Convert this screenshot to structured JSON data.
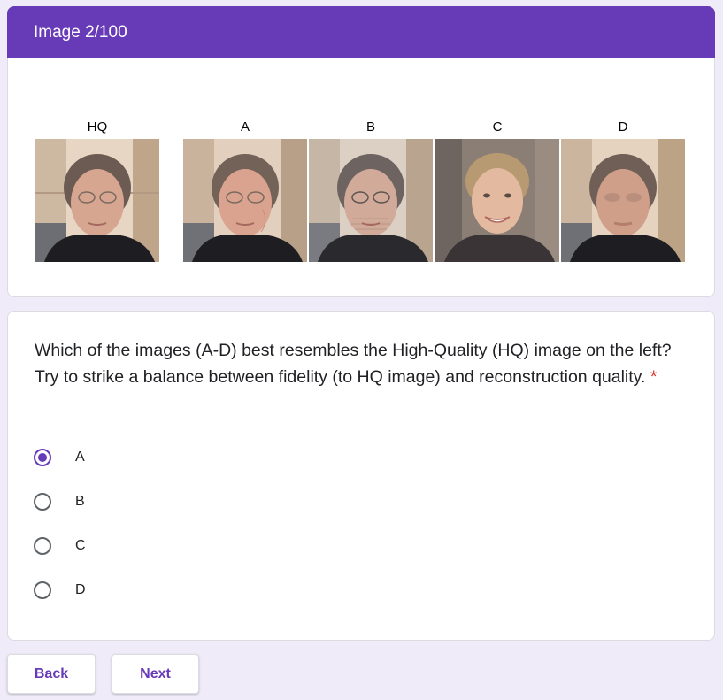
{
  "header": {
    "title": "Image 2/100"
  },
  "images": [
    {
      "label": "HQ",
      "icon": "face-photo-hq"
    },
    {
      "label": "A",
      "icon": "face-photo-a"
    },
    {
      "label": "B",
      "icon": "face-photo-b"
    },
    {
      "label": "C",
      "icon": "face-photo-c"
    },
    {
      "label": "D",
      "icon": "face-photo-d"
    }
  ],
  "question": {
    "text": "Which of the images (A-D) best resembles the High-Quality (HQ) image on the left? Try to strike a balance between fidelity (to HQ image) and reconstruction quality.",
    "required_mark": "*",
    "options": [
      {
        "label": "A",
        "selected": true
      },
      {
        "label": "B",
        "selected": false
      },
      {
        "label": "C",
        "selected": false
      },
      {
        "label": "D",
        "selected": false
      }
    ]
  },
  "buttons": {
    "back": "Back",
    "next": "Next"
  },
  "colors": {
    "accent": "#673ab7",
    "background": "#f0ebf8",
    "required": "#d93025"
  }
}
